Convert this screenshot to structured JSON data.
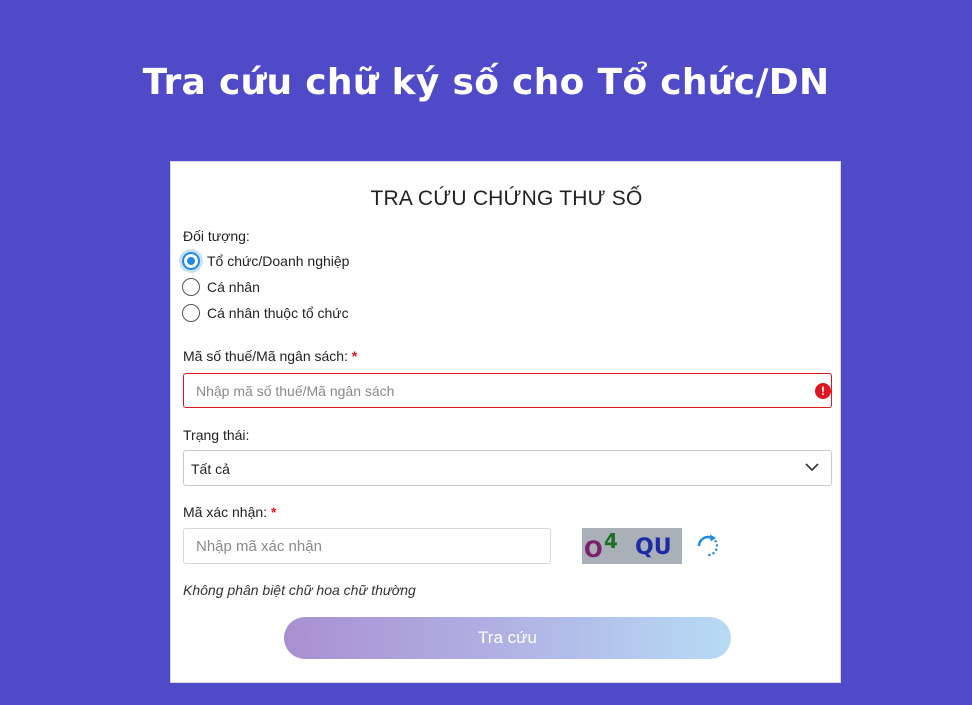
{
  "page": {
    "title": "Tra cứu chữ ký số cho Tổ chức/DN"
  },
  "form": {
    "title": "TRA CỨU CHỨNG THƯ SỐ",
    "subject": {
      "label": "Đối tượng:",
      "options": [
        {
          "label": "Tổ chức/Doanh nghiệp",
          "checked": true
        },
        {
          "label": "Cá nhân",
          "checked": false
        },
        {
          "label": "Cá nhân thuộc tổ chức",
          "checked": false
        }
      ]
    },
    "tax_code": {
      "label": "Mã số thuế/Mã ngân sách:",
      "required_mark": "*",
      "placeholder": "Nhập mã số thuế/Mã ngân sách",
      "value": "",
      "error_icon": "!"
    },
    "status": {
      "label": "Trạng thái:",
      "selected": "Tất cả"
    },
    "captcha": {
      "label": "Mã xác nhận:",
      "required_mark": "*",
      "placeholder": "Nhập mã xác nhận",
      "value": "",
      "image": {
        "part1": "O",
        "part2": "4",
        "part3": "QU"
      },
      "refresh_icon": "refresh-icon"
    },
    "hint": "Không phân biệt chữ hoa chữ thường",
    "submit_label": "Tra cứu"
  },
  "colors": {
    "background": "#4f4ac8",
    "error": "#e0161f",
    "radio_active": "#1e88e5",
    "button_start": "#a98fd0",
    "button_end": "#b6dbf5"
  }
}
